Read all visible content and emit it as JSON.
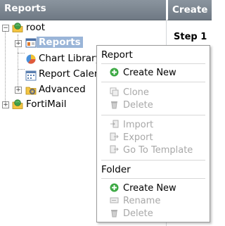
{
  "left_panel": {
    "title": "Reports"
  },
  "right_panel": {
    "title": "Create N",
    "step_label": "Step 1 -"
  },
  "tree": {
    "root": {
      "label": "root"
    },
    "children": [
      {
        "label": "Reports",
        "selected": true,
        "expandable": true
      },
      {
        "label": "Chart Library",
        "expandable": false
      },
      {
        "label": "Report Calendar",
        "expandable": false
      },
      {
        "label": "Advanced",
        "expandable": true
      }
    ],
    "fortimail": {
      "label": "FortiMail"
    }
  },
  "context_menu": {
    "report_section": "Report",
    "report_items": [
      {
        "label": "Create New",
        "enabled": true,
        "icon": "plus-icon"
      },
      {
        "label": "Clone",
        "enabled": false,
        "icon": "clone-icon"
      },
      {
        "label": "Delete",
        "enabled": false,
        "icon": "trash-icon"
      },
      {
        "label": "Import",
        "enabled": false,
        "icon": "import-icon"
      },
      {
        "label": "Export",
        "enabled": false,
        "icon": "export-icon"
      },
      {
        "label": "Go To Template",
        "enabled": false,
        "icon": "template-icon"
      }
    ],
    "folder_section": "Folder",
    "folder_items": [
      {
        "label": "Create New",
        "enabled": true,
        "icon": "plus-icon"
      },
      {
        "label": "Rename",
        "enabled": false,
        "icon": "rename-icon"
      },
      {
        "label": "Delete",
        "enabled": false,
        "icon": "trash-icon"
      }
    ]
  }
}
